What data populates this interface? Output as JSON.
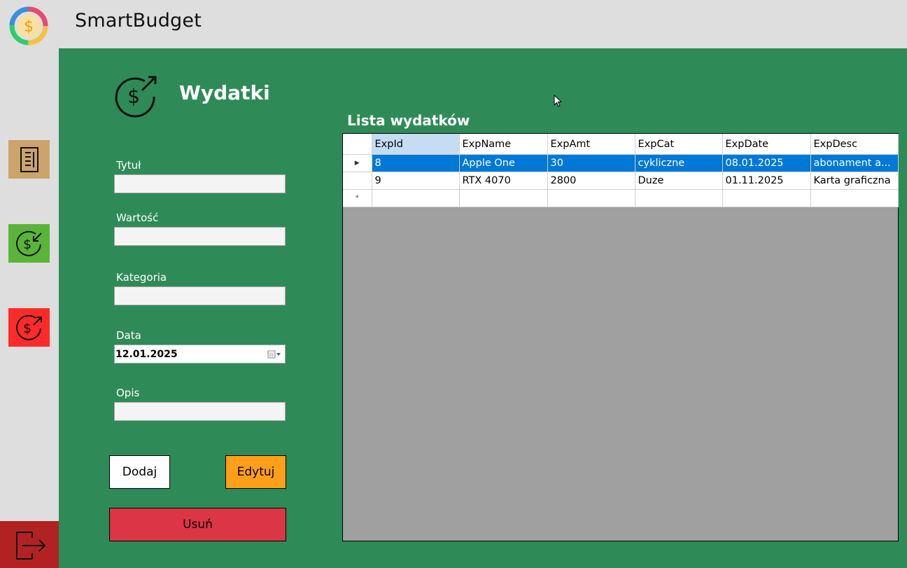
{
  "app": {
    "title": "SmartBudget"
  },
  "page": {
    "title": "Wydatki"
  },
  "form": {
    "title_label": "Tytuł",
    "title_value": "",
    "amount_label": "Wartość",
    "amount_value": "",
    "category_label": "Kategoria",
    "category_value": "",
    "date_label": "Data",
    "date_value": "12.01.2025",
    "desc_label": "Opis",
    "desc_value": ""
  },
  "buttons": {
    "add": "Dodaj",
    "edit": "Edytuj",
    "delete": "Usuń"
  },
  "list": {
    "title": "Lista wydatków",
    "columns": [
      "ExpId",
      "ExpName",
      "ExpAmt",
      "ExpCat",
      "ExpDate",
      "ExpDesc"
    ],
    "rows": [
      [
        "8",
        "Apple One",
        "30",
        "cykliczne",
        "08.01.2025",
        "abonament a..."
      ],
      [
        "9",
        "RTX 4070",
        "2800",
        "Duze",
        "01.11.2025",
        "Karta graficzna"
      ]
    ],
    "new_row_marker": "*"
  },
  "sidebar": {
    "items": [
      "summary-icon",
      "income-icon",
      "expense-icon"
    ],
    "colors": {
      "summary": "#caa46b",
      "income": "#5bb43a",
      "expense": "#ff2a2a",
      "logout": "#b22222"
    }
  },
  "theme": {
    "main_bg": "#2e8b57",
    "selected_row": "#0078d7",
    "edit_button": "#ff9f1a",
    "delete_button": "#dc3545"
  }
}
